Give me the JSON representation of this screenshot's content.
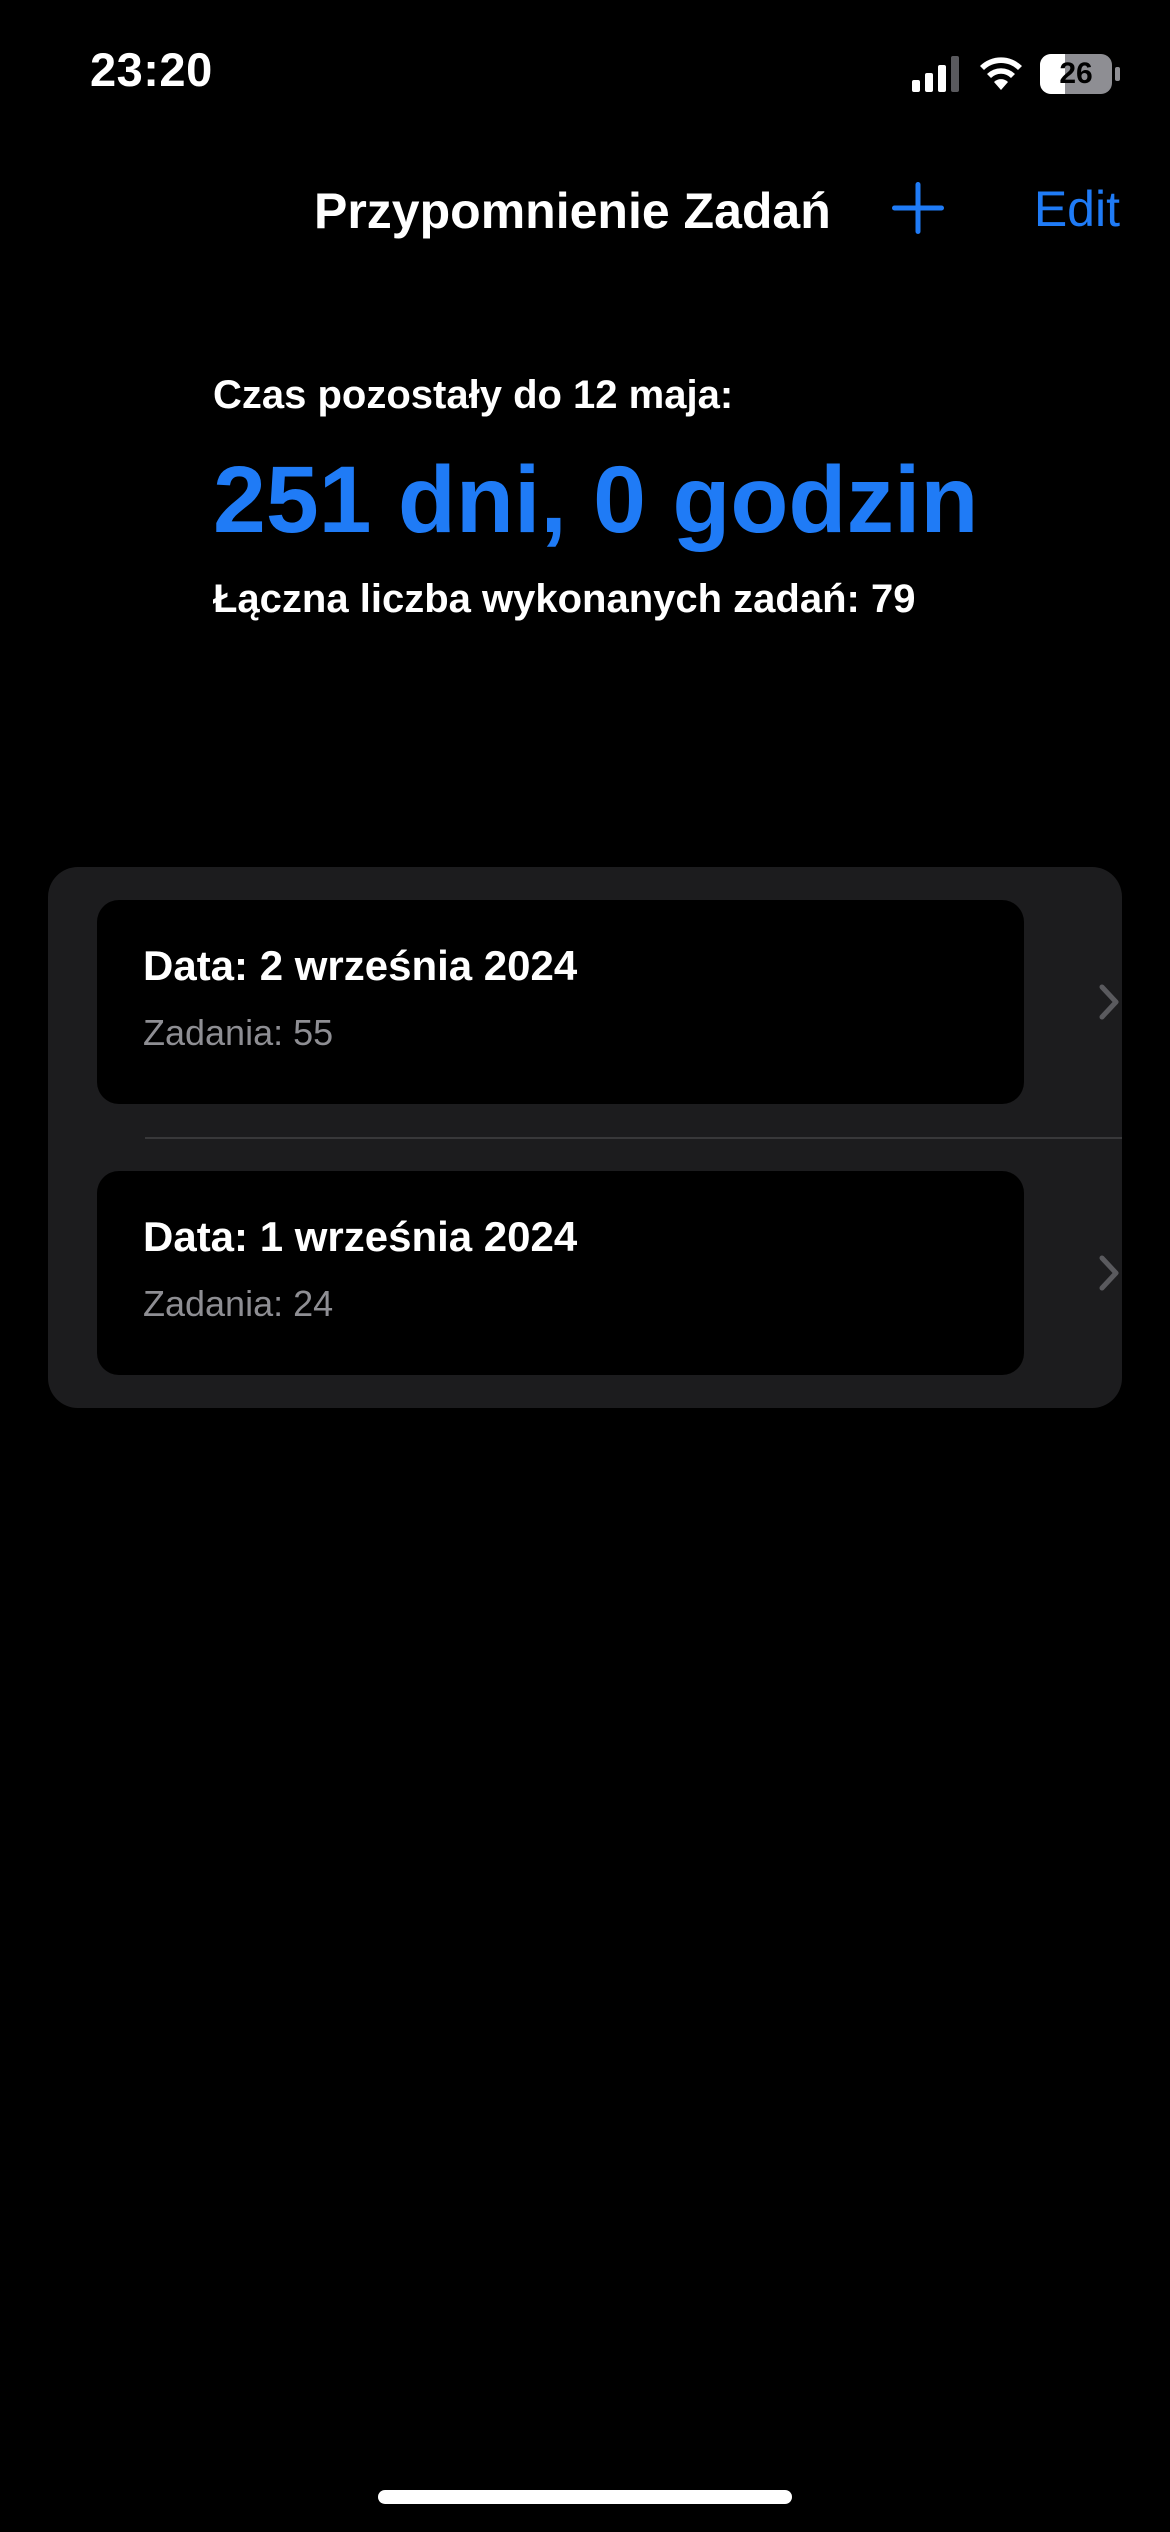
{
  "status_bar": {
    "time": "23:20",
    "battery_level": "26",
    "icons": [
      "signal-icon",
      "wifi-icon",
      "battery-icon"
    ]
  },
  "nav": {
    "title": "Przypomnienie Zadań",
    "add_icon": "plus-icon",
    "edit_label": "Edit"
  },
  "summary": {
    "countdown_label": "Czas pozostały do 12 maja:",
    "countdown_value": "251 dni, 0 godzin",
    "completed_total": "Łączna liczba wykonanych zadań: 79"
  },
  "entries": [
    {
      "title": "Data: 2 września 2024",
      "subtitle": "Zadania: 55"
    },
    {
      "title": "Data: 1 września 2024",
      "subtitle": "Zadania: 24"
    }
  ],
  "colors": {
    "background": "#000000",
    "accent": "#1f7bf6",
    "card": "#1c1c1e",
    "secondary_text": "#8e8e93"
  }
}
